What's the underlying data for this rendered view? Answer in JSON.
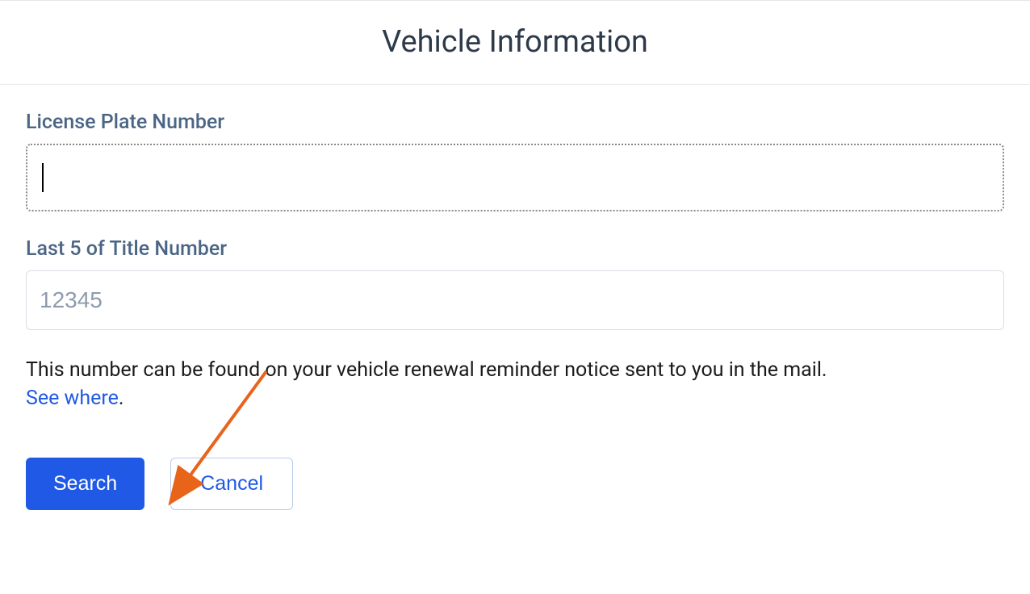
{
  "header": {
    "title": "Vehicle Information"
  },
  "fields": {
    "license_plate": {
      "label": "License Plate Number",
      "value": "",
      "placeholder": ""
    },
    "title_number": {
      "label": "Last 5 of Title Number",
      "value": "",
      "placeholder": "12345"
    }
  },
  "help": {
    "text": "This number can be found on your vehicle renewal reminder notice sent to you in the mail. ",
    "link_text": "See where",
    "suffix": "."
  },
  "buttons": {
    "search": "Search",
    "cancel": "Cancel"
  },
  "colors": {
    "primary_blue": "#2059e5",
    "label_slate": "#4b6584",
    "title_dark": "#2e3a4a",
    "annotation_orange": "#e8641b"
  }
}
